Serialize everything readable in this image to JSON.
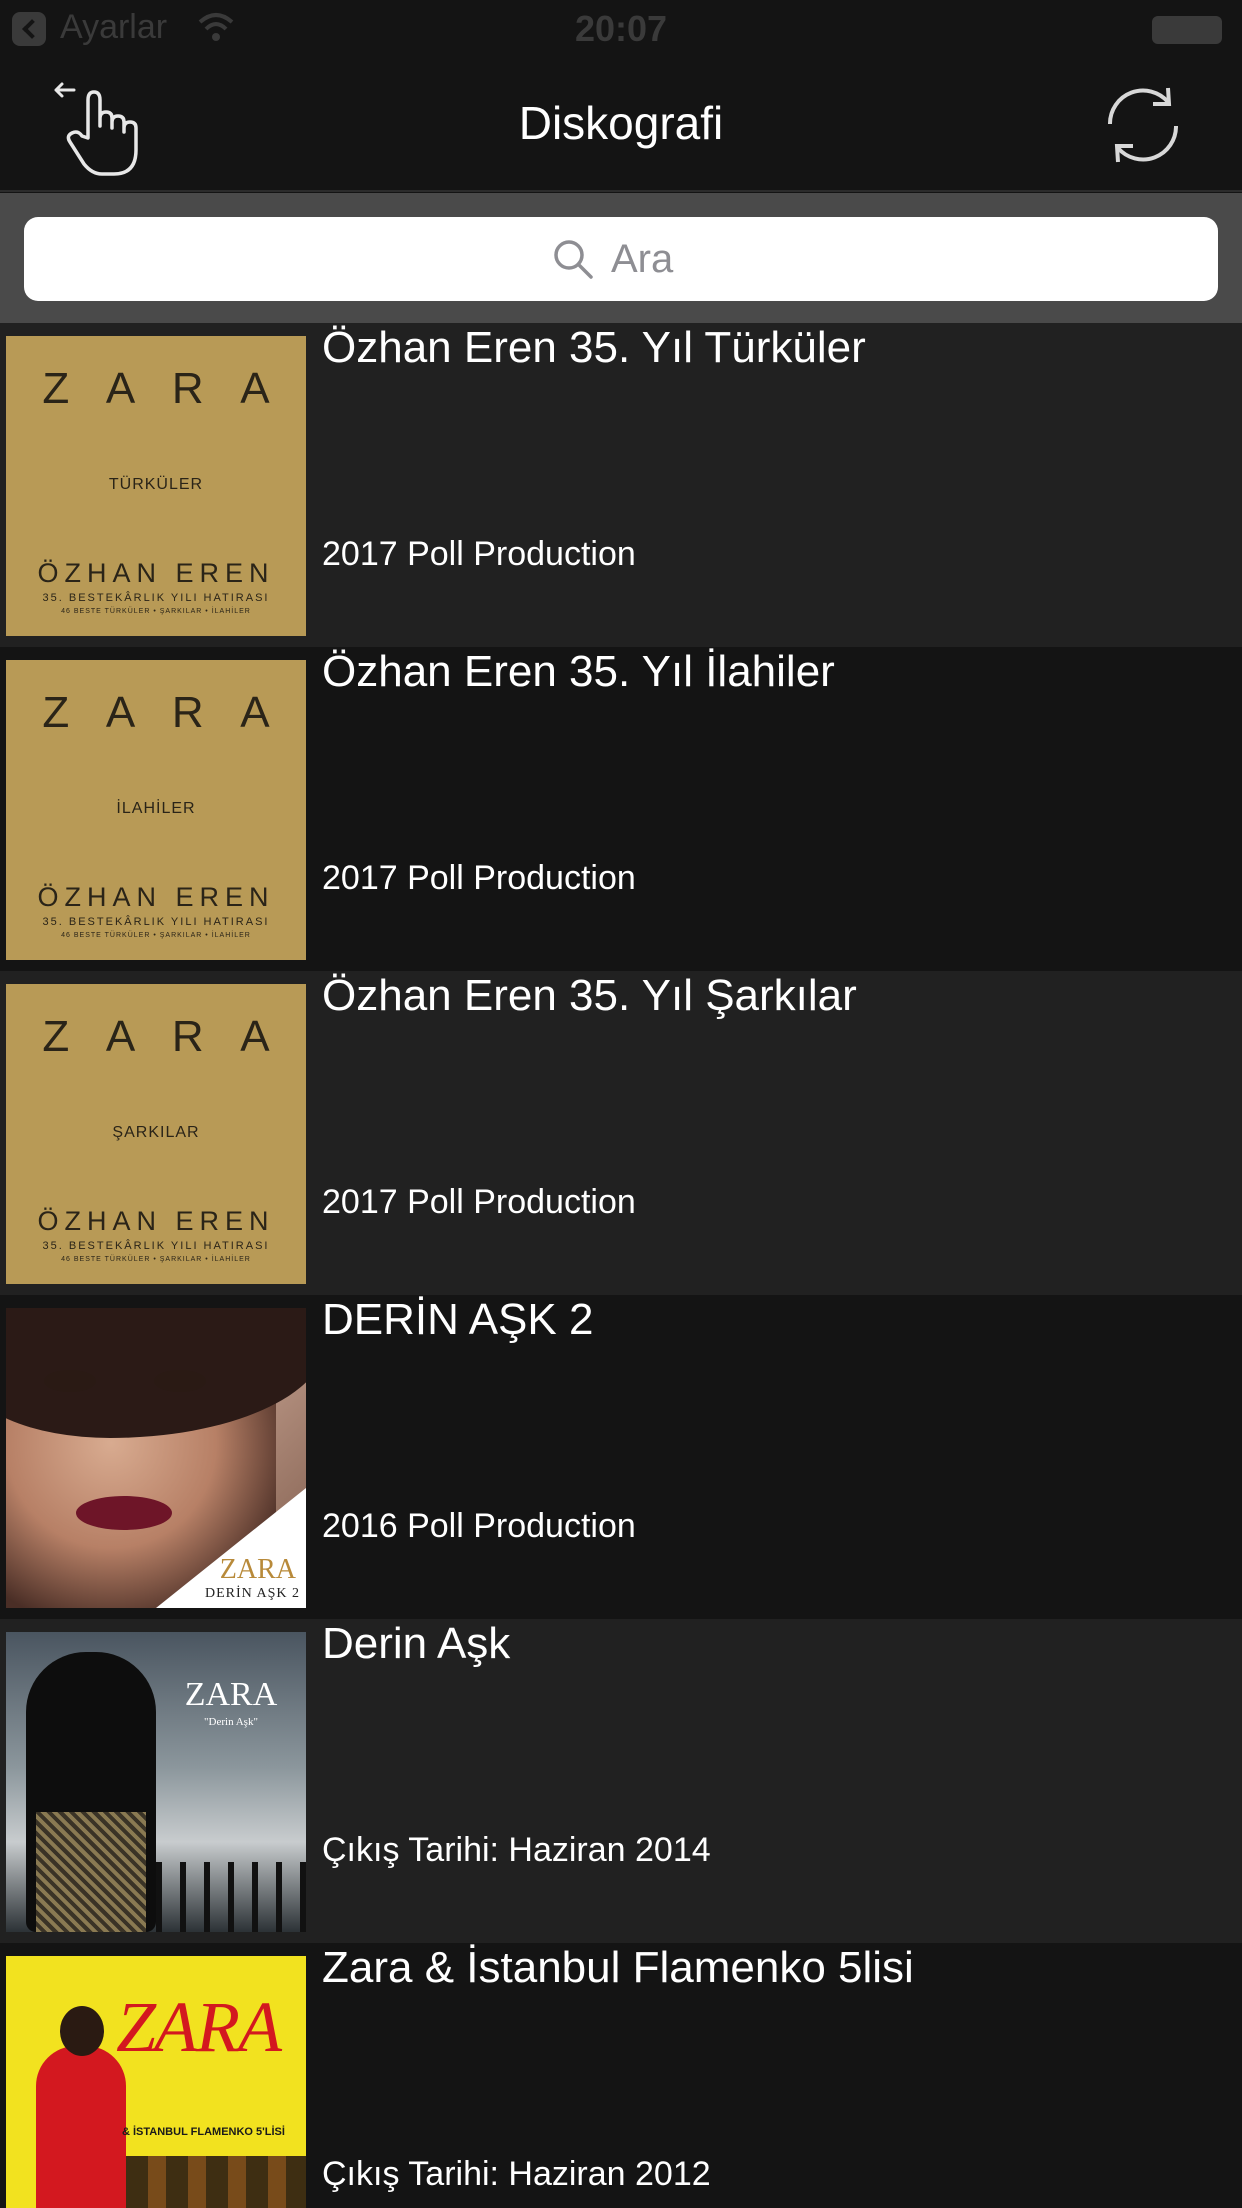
{
  "status_bar": {
    "carrier": "Ayarlar",
    "time": "20:07"
  },
  "nav": {
    "title": "Diskografi",
    "left_icon": "back-hand-icon",
    "right_icon": "refresh-icon"
  },
  "search": {
    "placeholder": "Ara"
  },
  "albums": [
    {
      "title": "Özhan Eren 35. Yıl Türküler",
      "subtitle": "2017 Poll Production",
      "cover": {
        "zara": [
          "Z",
          "A",
          "R",
          "A"
        ],
        "category": "TÜRKÜLER",
        "name": "ÖZHAN EREN",
        "line1": "35. BESTEKÂRLIK YILI HATIRASI",
        "line2": "46 BESTE TÜRKÜLER • ŞARKILAR • İLAHİLER"
      }
    },
    {
      "title": "Özhan Eren 35. Yıl İlahiler",
      "subtitle": "2017 Poll Production",
      "cover": {
        "zara": [
          "Z",
          "A",
          "R",
          "A"
        ],
        "category": "İLAHİLER",
        "name": "ÖZHAN EREN",
        "line1": "35. BESTEKÂRLIK YILI HATIRASI",
        "line2": "46 BESTE TÜRKÜLER • ŞARKILAR • İLAHİLER"
      }
    },
    {
      "title": "Özhan Eren 35. Yıl Şarkılar",
      "subtitle": "2017 Poll Production",
      "cover": {
        "zara": [
          "Z",
          "A",
          "R",
          "A"
        ],
        "category": "ŞARKILAR",
        "name": "ÖZHAN EREN",
        "line1": "35. BESTEKÂRLIK YILI HATIRASI",
        "line2": "46 BESTE TÜRKÜLER • ŞARKILAR • İLAHİLER"
      }
    },
    {
      "title": "DERİN AŞK 2",
      "subtitle": "2016 Poll Production",
      "cover": {
        "artist": "ZARA",
        "album": "DERİN AŞK 2"
      }
    },
    {
      "title": "Derin Aşk",
      "subtitle": "Çıkış Tarihi: Haziran 2014",
      "cover": {
        "artist": "ZARA",
        "album": "\"Derin Aşk\""
      }
    },
    {
      "title": "Zara & İstanbul Flamenko 5lisi",
      "subtitle": "Çıkış Tarihi: Haziran 2012",
      "cover": {
        "artist": "ZARA",
        "album": "& İSTANBUL FLAMENKO 5'LİSİ"
      }
    }
  ],
  "colors": {
    "background": "#141414",
    "row_alt": "#212121",
    "search_bar_bg": "#4a4a4a",
    "gold_cover": "#b89a56"
  }
}
